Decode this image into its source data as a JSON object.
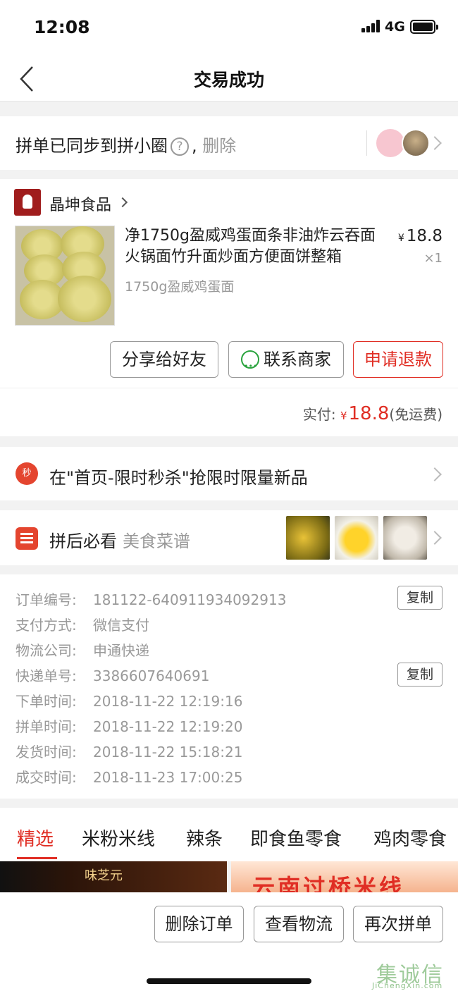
{
  "status": {
    "time": "12:08",
    "network": "4G"
  },
  "nav": {
    "title": "交易成功"
  },
  "sync": {
    "text": "拼单已同步到拼小圈",
    "help": "?",
    "sep": ",",
    "delete": "删除"
  },
  "shop": {
    "name": "晶坤食品"
  },
  "product": {
    "name": "净1750g盈威鸡蛋面条非油炸云吞面火锅面竹升面炒面方便面饼整箱",
    "spec": "1750g盈威鸡蛋面",
    "currency": "¥",
    "price": "18.8",
    "qty": "×1"
  },
  "actions": {
    "share": "分享给好友",
    "contact": "联系商家",
    "refund": "申请退款"
  },
  "payment": {
    "label": "实付:",
    "currency": "¥",
    "amount": "18.8",
    "note": "(免运费)"
  },
  "promo": {
    "icon": "秒",
    "text": "在\"首页-限时秒杀\"抢限时限量新品"
  },
  "recipe": {
    "title": "拼后必看",
    "subtitle": "美食菜谱"
  },
  "order_info": {
    "rows": [
      {
        "key": "订单编号:",
        "value": "181122-640911934092913"
      },
      {
        "key": "支付方式:",
        "value": "微信支付"
      },
      {
        "key": "物流公司:",
        "value": "申通快递"
      },
      {
        "key": "快递单号:",
        "value": "3386607640691"
      },
      {
        "key": "下单时间:",
        "value": "2018-11-22 12:19:16"
      },
      {
        "key": "拼单时间:",
        "value": "2018-11-22 12:19:20"
      },
      {
        "key": "发货时间:",
        "value": "2018-11-22 15:18:21"
      },
      {
        "key": "成交时间:",
        "value": "2018-11-23 17:00:25"
      }
    ],
    "copy_label": "复制"
  },
  "tabs": [
    "精选",
    "米粉米线",
    "辣条",
    "即食鱼零食",
    "鸡肉零食"
  ],
  "banners": {
    "b1": "味芝元",
    "b2": "云南过桥米线"
  },
  "bottom": {
    "delete": "删除订单",
    "logistics": "查看物流",
    "reorder": "再次拼单"
  },
  "watermark": {
    "text": "集诚信",
    "sub": "JiChengXin.com"
  },
  "colors": {
    "accent": "#e02e24",
    "wechat": "#2aa33e"
  }
}
